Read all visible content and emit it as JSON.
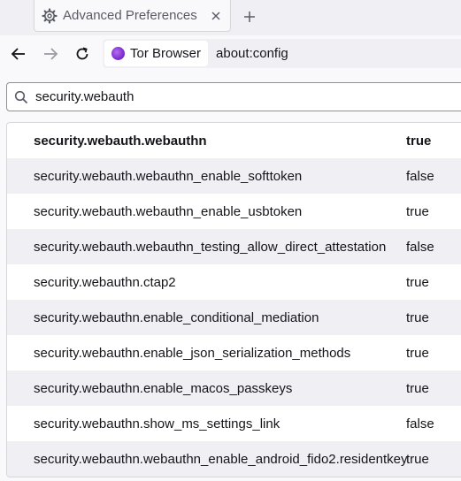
{
  "tab": {
    "title": "Advanced Preferences"
  },
  "navbar": {
    "identity_label": "Tor Browser",
    "url": "about:config"
  },
  "search": {
    "value": "security.webauth"
  },
  "prefs": [
    {
      "name": "security.webauth.webauthn",
      "value": "true",
      "modified": true
    },
    {
      "name": "security.webauth.webauthn_enable_softtoken",
      "value": "false",
      "modified": false
    },
    {
      "name": "security.webauth.webauthn_enable_usbtoken",
      "value": "true",
      "modified": false
    },
    {
      "name": "security.webauth.webauthn_testing_allow_direct_attestation",
      "value": "false",
      "modified": false
    },
    {
      "name": "security.webauthn.ctap2",
      "value": "true",
      "modified": false
    },
    {
      "name": "security.webauthn.enable_conditional_mediation",
      "value": "true",
      "modified": false
    },
    {
      "name": "security.webauthn.enable_json_serialization_methods",
      "value": "true",
      "modified": false
    },
    {
      "name": "security.webauthn.enable_macos_passkeys",
      "value": "true",
      "modified": false
    },
    {
      "name": "security.webauthn.show_ms_settings_link",
      "value": "false",
      "modified": false
    },
    {
      "name": "security.webauthn.webauthn_enable_android_fido2.residentkey",
      "value": "true",
      "modified": false
    }
  ]
}
